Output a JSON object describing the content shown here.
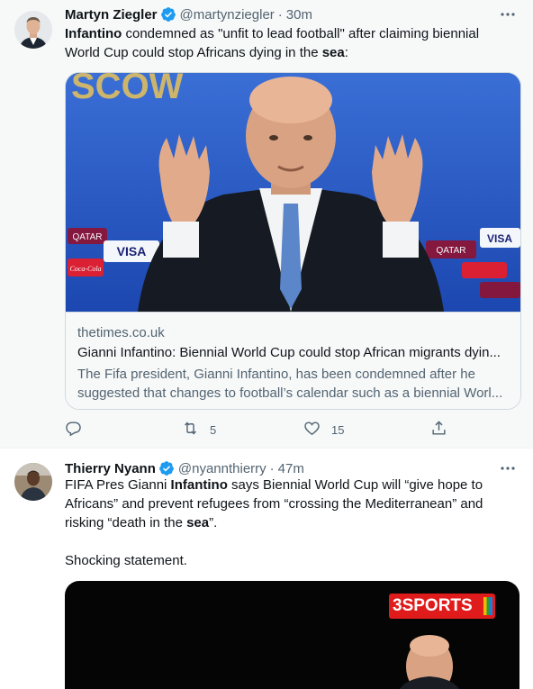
{
  "tweets": [
    {
      "name": "Martyn Ziegler",
      "handle": "@martynziegler",
      "separator": "·",
      "time": "30m",
      "text_parts": [
        {
          "bold": true,
          "text": "Infantino"
        },
        {
          "bold": false,
          "text": " condemned as \"unfit to lead football\" after claiming biennial World Cup could stop Africans dying in the "
        },
        {
          "bold": true,
          "text": "sea"
        },
        {
          "bold": false,
          "text": ":"
        }
      ],
      "card": {
        "image_text": "SCOW",
        "sponsor_text": [
          "QATAR",
          "VISA",
          "Coca-Cola",
          "QATAR",
          "VISA"
        ],
        "domain": "thetimes.co.uk",
        "title": "Gianni Infantino: Biennial World Cup could stop African migrants dyin...",
        "description": "The Fifa president, Gianni Infantino, has been condemned after he suggested that changes to football’s calendar such as a biennial Worl..."
      },
      "actions": {
        "reply": {
          "icon": "reply-icon",
          "count": ""
        },
        "retweet": {
          "icon": "retweet-icon",
          "count": "5"
        },
        "like": {
          "icon": "heart-icon",
          "count": "15"
        },
        "share": {
          "icon": "share-icon",
          "count": ""
        }
      }
    },
    {
      "name": "Thierry Nyann",
      "handle": "@nyannthierry",
      "separator": "·",
      "time": "47m",
      "text_parts": [
        {
          "bold": false,
          "text": "FIFA Pres Gianni "
        },
        {
          "bold": true,
          "text": "Infantino"
        },
        {
          "bold": false,
          "text": " says Biennial World Cup will “give hope to Africans” and prevent refugees from “crossing the Mediterranean” and risking “death in the "
        },
        {
          "bold": true,
          "text": "sea"
        },
        {
          "bold": false,
          "text": "”."
        },
        {
          "bold": false,
          "text": "\n\nShocking statement."
        }
      ],
      "media": {
        "logo_text": "3SPORTS"
      }
    }
  ],
  "colors": {
    "verified": "#1d9bf0",
    "secondary_text": "#536471",
    "hover_bg": "#f7f9f9",
    "border": "#cfd9de"
  }
}
